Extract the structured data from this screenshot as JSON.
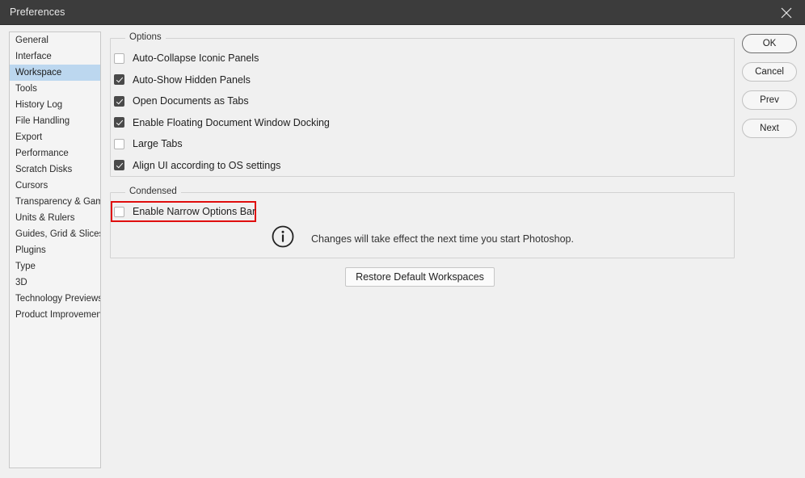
{
  "window": {
    "title": "Preferences",
    "close_icon": "close-icon"
  },
  "sidebar": {
    "items": [
      {
        "label": "General",
        "selected": false
      },
      {
        "label": "Interface",
        "selected": false
      },
      {
        "label": "Workspace",
        "selected": true
      },
      {
        "label": "Tools",
        "selected": false
      },
      {
        "label": "History Log",
        "selected": false
      },
      {
        "label": "File Handling",
        "selected": false
      },
      {
        "label": "Export",
        "selected": false
      },
      {
        "label": "Performance",
        "selected": false
      },
      {
        "label": "Scratch Disks",
        "selected": false
      },
      {
        "label": "Cursors",
        "selected": false
      },
      {
        "label": "Transparency & Gamut",
        "selected": false
      },
      {
        "label": "Units & Rulers",
        "selected": false
      },
      {
        "label": "Guides, Grid & Slices",
        "selected": false
      },
      {
        "label": "Plugins",
        "selected": false
      },
      {
        "label": "Type",
        "selected": false
      },
      {
        "label": "3D",
        "selected": false
      },
      {
        "label": "Technology Previews",
        "selected": false
      },
      {
        "label": "Product Improvement",
        "selected": false
      }
    ]
  },
  "side_buttons": {
    "ok": "OK",
    "cancel": "Cancel",
    "prev": "Prev",
    "next": "Next"
  },
  "options_group": {
    "title": "Options",
    "checkboxes": [
      {
        "label": "Auto-Collapse Iconic Panels",
        "checked": false
      },
      {
        "label": "Auto-Show Hidden Panels",
        "checked": true
      },
      {
        "label": "Open Documents as Tabs",
        "checked": true
      },
      {
        "label": "Enable Floating Document Window Docking",
        "checked": true
      },
      {
        "label": "Large Tabs",
        "checked": false
      },
      {
        "label": "Align UI according to OS settings",
        "checked": true
      }
    ]
  },
  "condensed_group": {
    "title": "Condensed",
    "checkboxes": [
      {
        "label": "Enable Narrow Options Bar",
        "checked": false
      }
    ]
  },
  "info_note": {
    "icon": "info-icon",
    "text": "Changes will take effect the next time you start Photoshop."
  },
  "restore_button": {
    "label": "Restore Default Workspaces"
  },
  "annotation": {
    "highlight_color": "#e00d0d",
    "target": "Enable Narrow Options Bar"
  },
  "colors": {
    "titlebar_bg": "#3c3c3c",
    "dialog_bg": "#f0f0f0",
    "selection_bg": "#bcd7ef",
    "checkbox_checked_bg": "#4a4a4a"
  }
}
